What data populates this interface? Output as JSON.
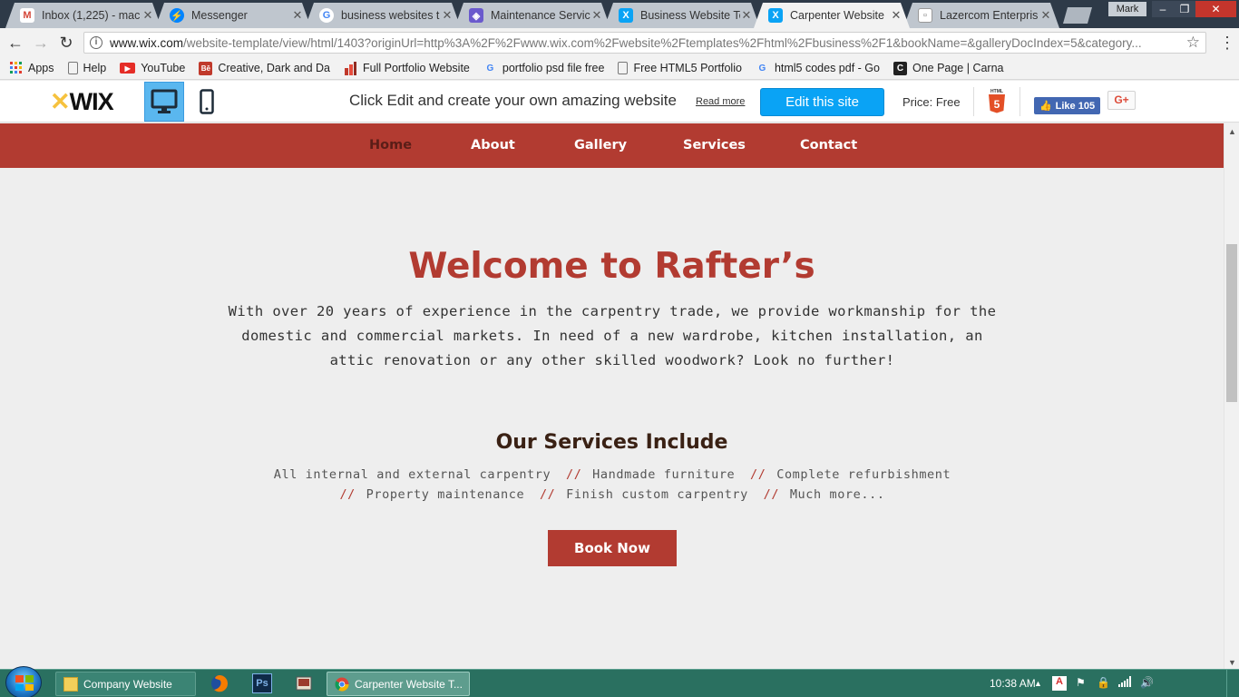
{
  "browser": {
    "tabs": [
      {
        "title": "Inbox (1,225) - mac",
        "icon": "gmail-icon",
        "color": "#d44638"
      },
      {
        "title": "Messenger",
        "icon": "messenger-icon",
        "color": "#0084ff"
      },
      {
        "title": "business websites t",
        "icon": "google-icon",
        "color": "#4285f4"
      },
      {
        "title": "Maintenance Servic",
        "icon": "shield-icon",
        "color": "#6a5acd"
      },
      {
        "title": "Business Website Te",
        "icon": "wix-icon",
        "color": "#0aa3f5"
      },
      {
        "title": "Carpenter Website",
        "icon": "wix-icon",
        "color": "#0aa3f5",
        "active": true
      },
      {
        "title": "Lazercom Enterpris",
        "icon": "page-icon",
        "color": "#777777"
      }
    ],
    "profile_name": "Mark",
    "url_host": "www.wix.com",
    "url_path": "/website-template/view/html/1403?originUrl=http%3A%2F%2Fwww.wix.com%2Fwebsite%2Ftemplates%2Fhtml%2Fbusiness%2F1&bookName=&galleryDocIndex=5&category..."
  },
  "bookmarks": [
    {
      "label": "Apps",
      "icon": "apps-grid-icon"
    },
    {
      "label": "Help",
      "icon": "page-icon"
    },
    {
      "label": "YouTube",
      "icon": "youtube-icon"
    },
    {
      "label": "Creative, Dark and Da",
      "icon": "behance-icon"
    },
    {
      "label": "Full Portfolio Website",
      "icon": "chart-bar-icon"
    },
    {
      "label": "portfolio psd file free",
      "icon": "google-icon"
    },
    {
      "label": "Free HTML5 Portfolio",
      "icon": "page-icon"
    },
    {
      "label": "html5 codes pdf - Go",
      "icon": "google-icon"
    },
    {
      "label": "One Page | Carna",
      "icon": "carna-icon"
    }
  ],
  "wix_bar": {
    "logo": "WIX",
    "cta_text": "Click Edit and create your own amazing website",
    "read_more": "Read more",
    "edit_button": "Edit this site",
    "price": "Price: Free",
    "html5_label": "HTML",
    "fb_like": "Like 105",
    "gplus": "G+"
  },
  "site": {
    "nav": [
      "Home",
      "About",
      "Gallery",
      "Services",
      "Contact"
    ],
    "headline": "Welcome to Rafter’s",
    "intro": "With over 20 years of experience in the carpentry trade, we provide workmanship for the domestic and commercial markets. In need of a new wardrobe, kitchen installation, an attic renovation or any other skilled woodwork? Look no further!",
    "services_title": "Our Services Include",
    "services": [
      "All internal and external carpentry",
      "Handmade furniture",
      "Complete refurbishment",
      "Property maintenance",
      "Finish custom carpentry",
      "Much more..."
    ],
    "separator": "//",
    "book_button": "Book Now",
    "accent_color": "#b23b31"
  },
  "taskbar": {
    "items": [
      {
        "label": "Company Website",
        "icon": "folder-icon"
      },
      {
        "label": "Carpenter Website T...",
        "icon": "chrome-icon"
      }
    ],
    "clock": "10:38 AM"
  }
}
